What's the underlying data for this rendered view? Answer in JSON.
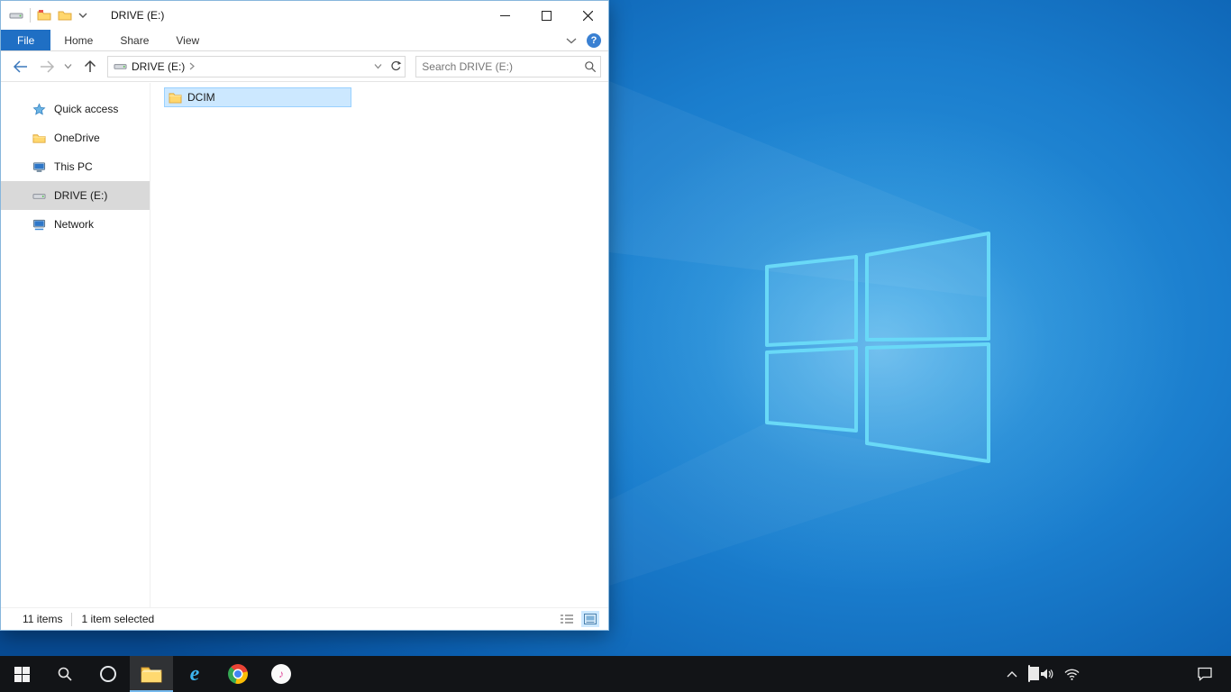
{
  "colors": {
    "accent": "#0078d7",
    "selection_bg": "#cce8ff",
    "selection_border": "#99d1ff",
    "file_tab": "#1f6fc4",
    "sidebar_selected": "#d9d9d9",
    "taskbar_bg": "#121417",
    "taskbar_active_underline": "#76b9ed"
  },
  "explorer": {
    "title": "DRIVE (E:)",
    "ribbon": {
      "file": "File",
      "home": "Home",
      "share": "Share",
      "view": "View"
    },
    "nav": {
      "breadcrumb_root": "DRIVE (E:)"
    },
    "search": {
      "placeholder": "Search DRIVE (E:)"
    },
    "sidebar": [
      {
        "label": "Quick access",
        "icon": "star-icon"
      },
      {
        "label": "OneDrive",
        "icon": "folder-icon"
      },
      {
        "label": "This PC",
        "icon": "monitor-icon"
      },
      {
        "label": "DRIVE (E:)",
        "icon": "drive-icon",
        "selected": true
      },
      {
        "label": "Network",
        "icon": "network-icon"
      }
    ],
    "files": [
      {
        "name": "DCIM",
        "icon": "folder-icon",
        "selected": true
      }
    ],
    "status": {
      "count": "11 items",
      "selected": "1 item selected"
    }
  },
  "taskbar": {
    "buttons": [
      {
        "name": "start"
      },
      {
        "name": "search"
      },
      {
        "name": "cortana"
      },
      {
        "name": "file-explorer",
        "active": true
      },
      {
        "name": "internet-explorer"
      },
      {
        "name": "chrome"
      },
      {
        "name": "itunes"
      }
    ],
    "tray": [
      {
        "name": "hidden-icons"
      },
      {
        "name": "battery"
      },
      {
        "name": "volume"
      },
      {
        "name": "network"
      },
      {
        "name": "action-center"
      }
    ]
  }
}
